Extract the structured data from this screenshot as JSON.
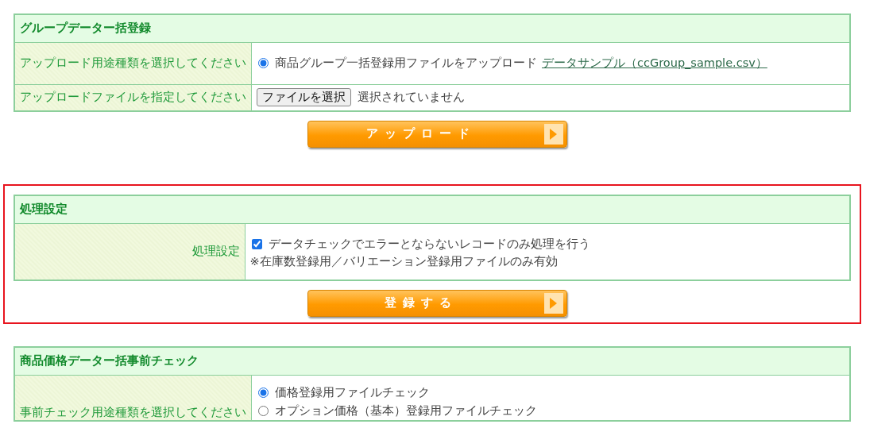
{
  "sections": [
    {
      "title": "グループデーター括登録",
      "highlighted": false,
      "rows": [
        {
          "label": "アップロード用途種類を選択してください",
          "kind": "radio",
          "options": [
            {
              "label": "商品グループ一括登録用ファイルをアップロード",
              "selected": true,
              "link": "データサンプル（ccGroup_sample.csv）"
            }
          ]
        },
        {
          "label": "アップロードファイルを指定してください",
          "kind": "file",
          "button": "ファイルを選択",
          "status": "選択されていません"
        }
      ],
      "button": "アップロード"
    },
    {
      "title": "処理設定",
      "highlighted": true,
      "rows": [
        {
          "label": "処理設定",
          "kind": "checkbox",
          "checked": true,
          "text": "データチェックでエラーとならないレコードのみ処理を行う",
          "note": "※在庫数登録用／バリエーション登録用ファイルのみ有効"
        }
      ],
      "button": "登録する"
    },
    {
      "title": "商品価格データー括事前チェック",
      "highlighted": false,
      "rows": [
        {
          "label": "事前チェック用途種類を選択してください",
          "kind": "radio",
          "options": [
            {
              "label": "価格登録用ファイルチェック",
              "selected": true
            },
            {
              "label": "オプション価格（基本）登録用ファイルチェック",
              "selected": false
            }
          ]
        }
      ]
    }
  ]
}
